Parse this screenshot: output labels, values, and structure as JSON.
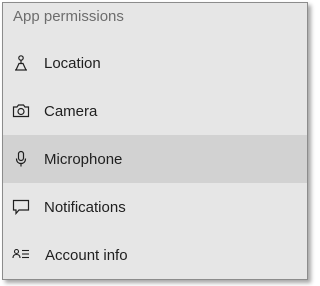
{
  "panel": {
    "header": "App permissions",
    "items": [
      {
        "label": "Location",
        "icon": "location-icon",
        "selected": false
      },
      {
        "label": "Camera",
        "icon": "camera-icon",
        "selected": false
      },
      {
        "label": "Microphone",
        "icon": "microphone-icon",
        "selected": true
      },
      {
        "label": "Notifications",
        "icon": "notifications-icon",
        "selected": false
      },
      {
        "label": "Account info",
        "icon": "account-info-icon",
        "selected": false
      }
    ]
  },
  "colors": {
    "background": "#e6e6e6",
    "selected_background": "#d2d2d2",
    "header_text": "#6d6d6d",
    "item_text": "#1f1f1f"
  }
}
